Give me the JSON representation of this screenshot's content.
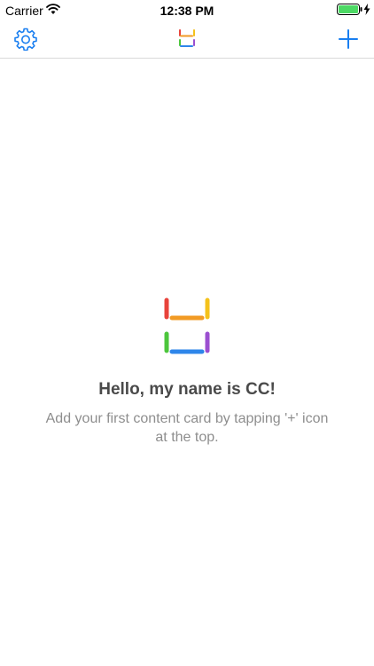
{
  "status_bar": {
    "carrier": "Carrier",
    "time": "12:38 PM",
    "icons": [
      "wifi-icon",
      "battery-icon",
      "charging-icon"
    ]
  },
  "nav_bar": {
    "left_icon": "gear-icon",
    "center_icon": "app-logo-icon",
    "right_icon": "plus-icon"
  },
  "empty_state": {
    "title": "Hello, my name is CC!",
    "subtitle": "Add your first content card by tapping '+' icon at the top."
  },
  "colors": {
    "accent": "#1a7ff0",
    "title_text": "#4a4a4a",
    "subtitle_text": "#8e8e8e",
    "logo_red": "#e8433b",
    "logo_orange": "#f29b24",
    "logo_yellow": "#f4c21b",
    "logo_green": "#4cc63c",
    "logo_blue": "#2e86ea",
    "logo_purple": "#9b4fd0"
  }
}
